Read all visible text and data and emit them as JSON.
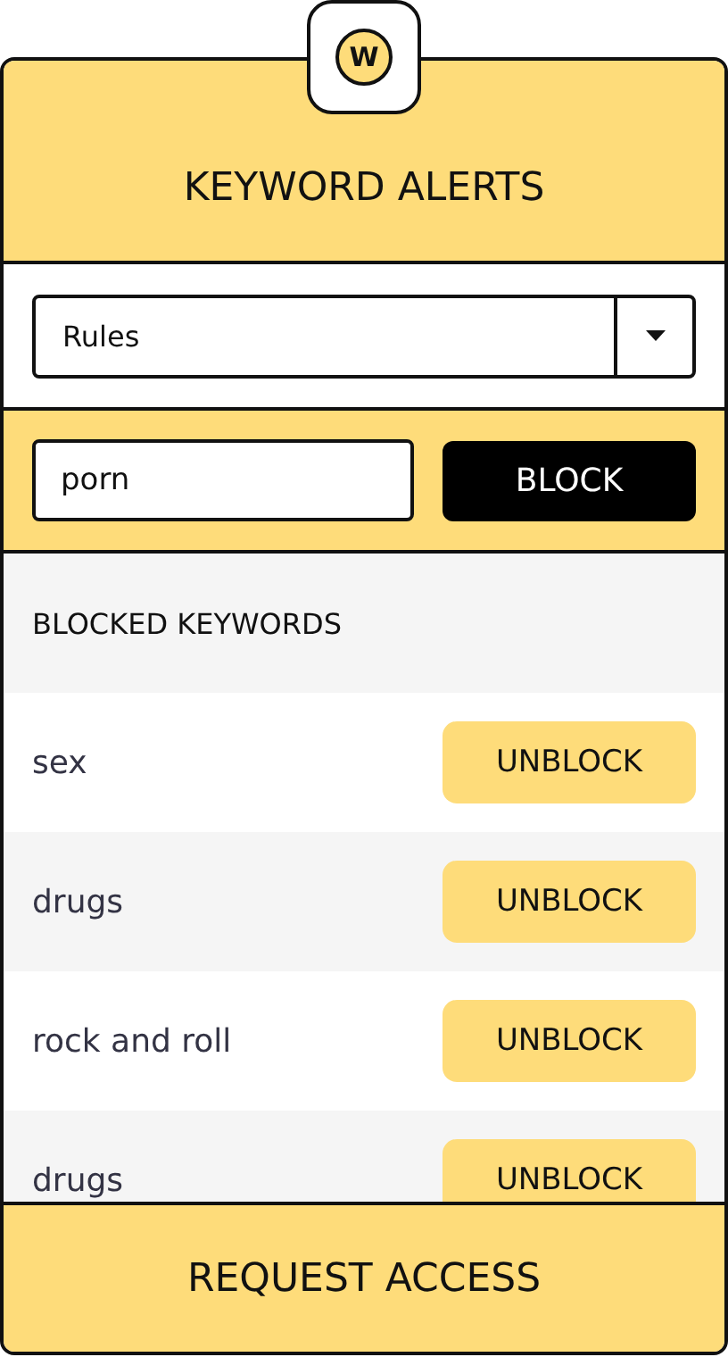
{
  "logo": {
    "letter": "W"
  },
  "header": {
    "title": "KEYWORD ALERTS"
  },
  "select": {
    "value": "Rules"
  },
  "block_form": {
    "value": "porn",
    "button": "BLOCK"
  },
  "blocked_list": {
    "heading": "BLOCKED KEYWORDS",
    "items": [
      {
        "keyword": "sex",
        "button": "UNBLOCK"
      },
      {
        "keyword": "drugs",
        "button": "UNBLOCK"
      },
      {
        "keyword": "rock and roll",
        "button": "UNBLOCK"
      },
      {
        "keyword": "drugs",
        "button": "UNBLOCK"
      }
    ]
  },
  "footer": {
    "button": "REQUEST ACCESS"
  }
}
